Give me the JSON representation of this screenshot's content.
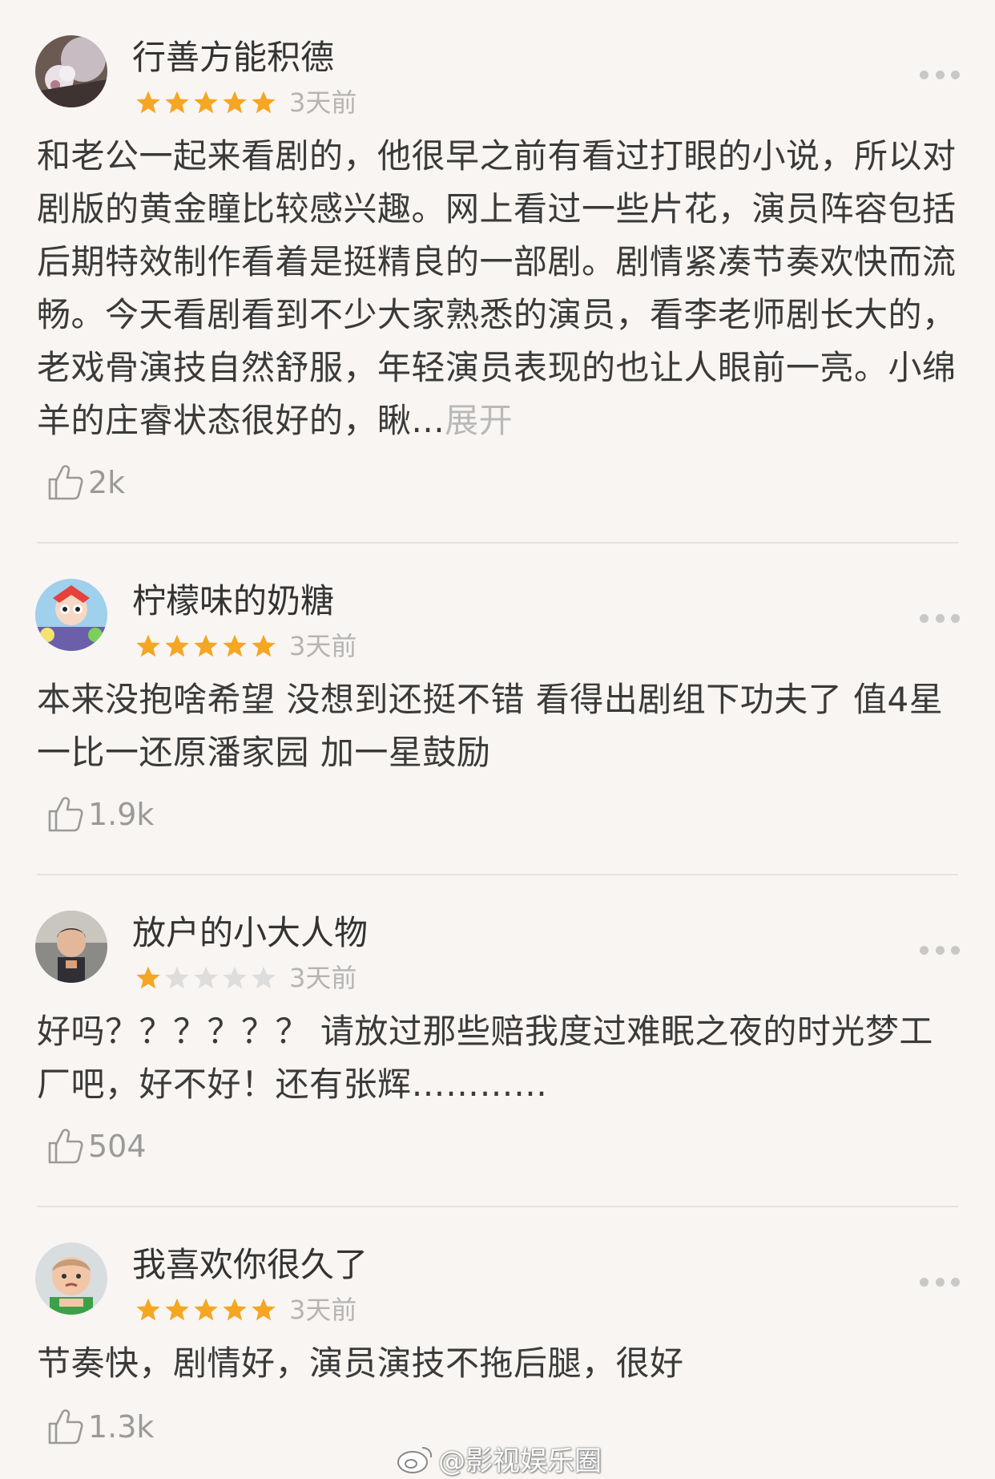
{
  "reviews": [
    {
      "username": "行善方能积德",
      "rating": 5,
      "time": "3天前",
      "text": "和老公一起来看剧的，他很早之前有看过打眼的小说，所以对剧版的黄金瞳比较感兴趣。网上看过一些片花，演员阵容包括后期特效制作看着是挺精良的一部剧。剧情紧凑节奏欢快而流畅。今天看剧看到不少大家熟悉的演员，看李老师剧长大的，老戏骨演技自然舒服，年轻演员表现的也让人眼前一亮。小绵羊的庄睿状态很好的，瞅...",
      "expand": "展开",
      "likes": "2k",
      "avatar": "cherry-blossom-avatar"
    },
    {
      "username": "柠檬味的奶糖",
      "rating": 5,
      "time": "3天前",
      "text": "本来没抱啥希望 没想到还挺不错 看得出剧组下功夫了 值4星一比一还原潘家园 加一星鼓励",
      "likes": "1.9k",
      "avatar": "cartoon-girl-avatar"
    },
    {
      "username": "放户的小大人物",
      "rating": 1,
      "time": "3天前",
      "text": "好吗？？？？？？ 请放过那些赔我度过难眠之夜的时光梦工厂吧，好不好！还有张辉…………",
      "likes": "504",
      "avatar": "child-photo-avatar"
    },
    {
      "username": "我喜欢你很久了",
      "rating": 5,
      "time": "3天前",
      "text": "节奏快，剧情好，演员演技不拖后腿，很好",
      "likes": "1.3k",
      "avatar": "baby-photo-avatar"
    }
  ],
  "colors": {
    "star_filled": "#f5a623",
    "star_empty": "#dddddd",
    "background": "#f8f5f2"
  },
  "watermark": "@影视娱乐圈"
}
